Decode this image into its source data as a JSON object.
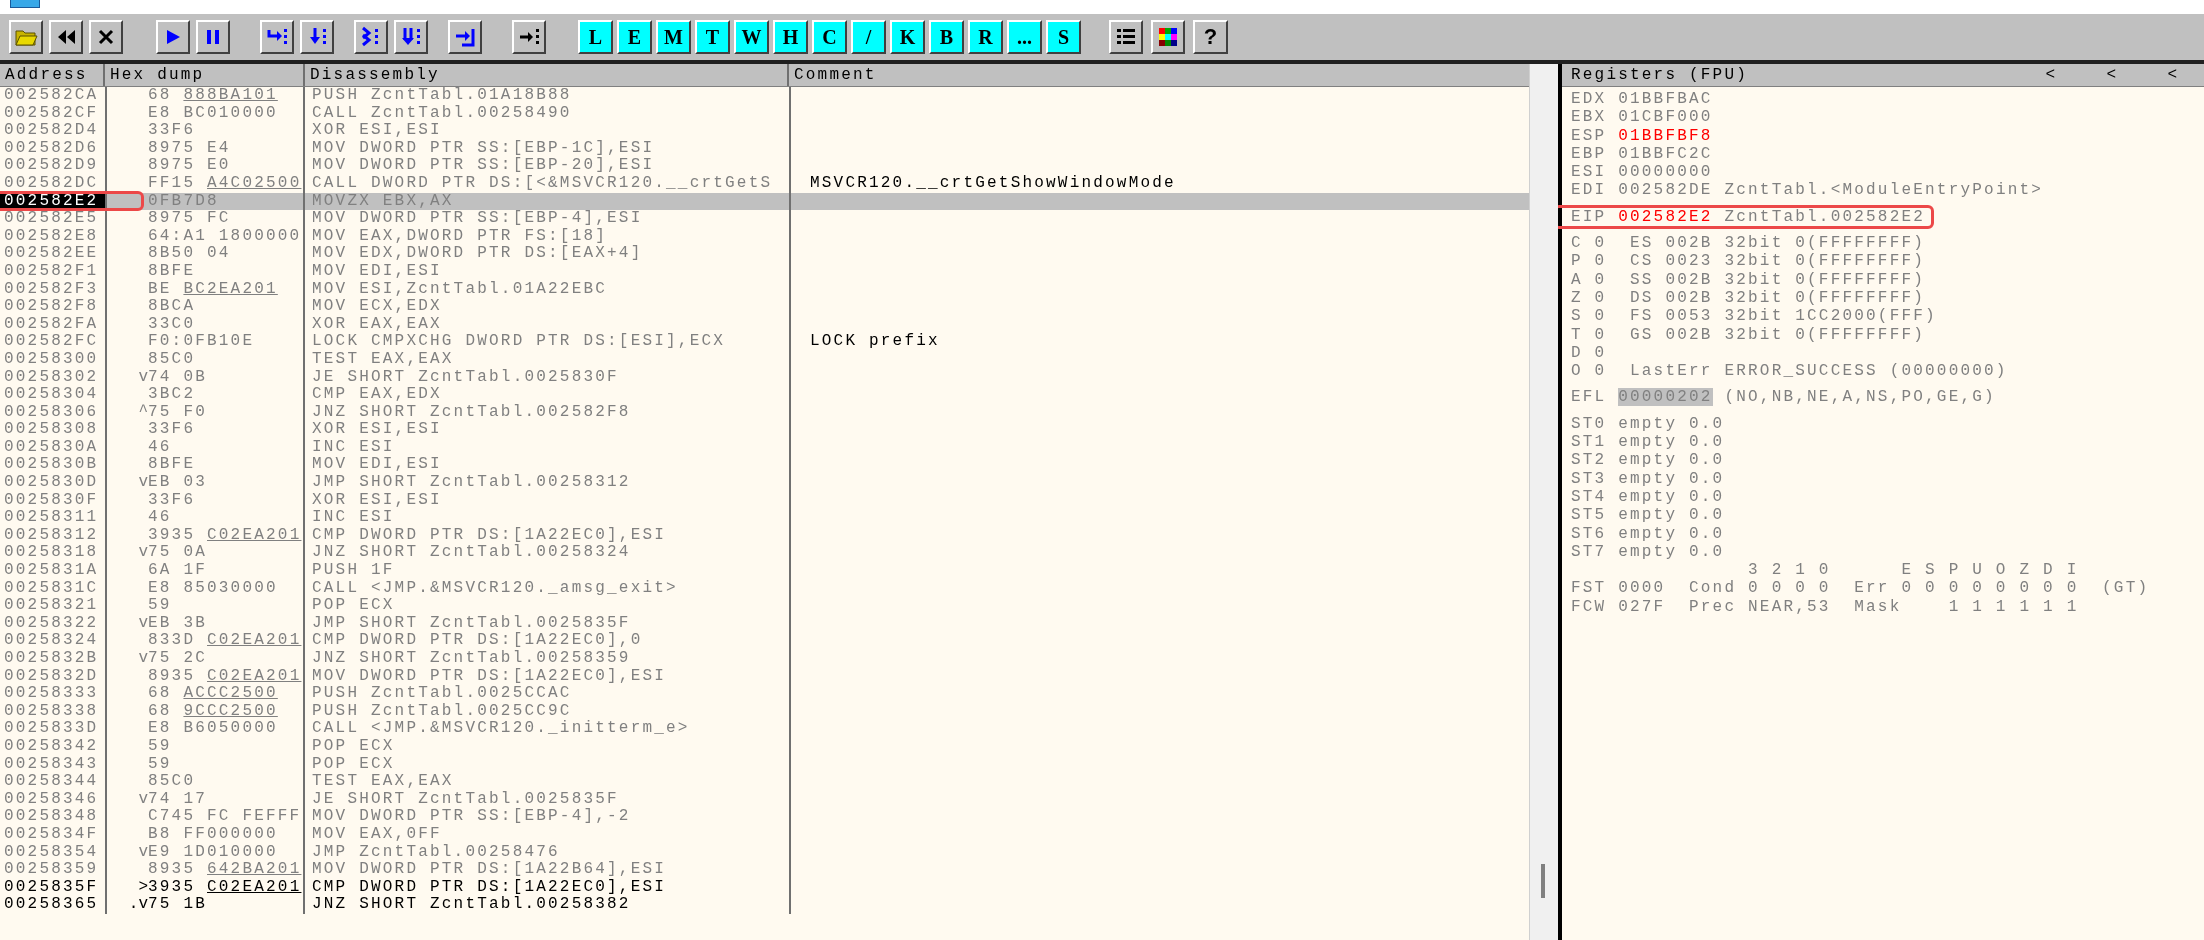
{
  "toolbar": {
    "letter_buttons": [
      "L",
      "E",
      "M",
      "T",
      "W",
      "H",
      "C",
      "/",
      "K",
      "B",
      "R",
      "...",
      "S"
    ],
    "help_button": "?"
  },
  "cpu": {
    "columns": [
      "Address",
      "Hex dump",
      "Disassembly",
      "Comment"
    ],
    "rows": [
      {
        "address": "002582CA",
        "hex": "68 ",
        "fixup": "888BA101",
        "disassembly": "PUSH ZcntTabl.01A18B88",
        "selected": false,
        "traced": false
      },
      {
        "address": "002582CF",
        "hex": "E8 BC010000",
        "disassembly": "CALL ZcntTabl.00258490",
        "selected": false,
        "traced": false
      },
      {
        "address": "002582D4",
        "hex": "33F6",
        "disassembly": "XOR ESI,ESI",
        "selected": false,
        "traced": false
      },
      {
        "address": "002582D6",
        "hex": "8975 E4",
        "disassembly": "MOV DWORD PTR SS:[EBP-1C],ESI",
        "selected": false,
        "traced": false
      },
      {
        "address": "002582D9",
        "hex": "8975 E0",
        "disassembly": "MOV DWORD PTR SS:[EBP-20],ESI",
        "selected": false,
        "traced": false
      },
      {
        "address": "002582DC",
        "hex": "FF15 ",
        "fixup": "A4C02500",
        "disassembly": "CALL DWORD PTR DS:[<&MSVCR120.__crtGetS",
        "comment": "MSVCR120.__crtGetShowWindowMode",
        "selected": false,
        "traced": false
      },
      {
        "address": "002582E2",
        "hex": "0FB7D8",
        "disassembly": "MOVZX EBX,AX",
        "selected": true,
        "traced": false
      },
      {
        "address": "002582E5",
        "hex": "8975 FC",
        "disassembly": "MOV DWORD PTR SS:[EBP-4],ESI",
        "selected": false,
        "traced": false
      },
      {
        "address": "002582E8",
        "hex": "64:A1 1800000",
        "disassembly": "MOV EAX,DWORD PTR FS:[18]",
        "selected": false,
        "traced": false
      },
      {
        "address": "002582EE",
        "hex": "8B50 04",
        "disassembly": "MOV EDX,DWORD PTR DS:[EAX+4]",
        "selected": false,
        "traced": false
      },
      {
        "address": "002582F1",
        "hex": "8BFE",
        "disassembly": "MOV EDI,ESI",
        "selected": false,
        "traced": false
      },
      {
        "address": "002582F3",
        "hex": "BE ",
        "fixup": "BC2EA201",
        "disassembly": "MOV ESI,ZcntTabl.01A22EBC",
        "selected": false,
        "traced": false
      },
      {
        "address": "002582F8",
        "hex": "8BCA",
        "disassembly": "MOV ECX,EDX",
        "selected": false,
        "traced": false
      },
      {
        "address": "002582FA",
        "hex": "33C0",
        "disassembly": "XOR EAX,EAX",
        "selected": false,
        "traced": false
      },
      {
        "address": "002582FC",
        "hex": "F0:0FB10E",
        "disassembly": "LOCK CMPXCHG DWORD PTR DS:[ESI],ECX",
        "comment": "LOCK prefix",
        "selected": false,
        "traced": false
      },
      {
        "address": "00258300",
        "hex": "85C0",
        "disassembly": "TEST EAX,EAX",
        "selected": false,
        "traced": false
      },
      {
        "address": "00258302",
        "mark": "v",
        "hex": "74 0B",
        "disassembly": "JE SHORT ZcntTabl.0025830F",
        "selected": false,
        "traced": false
      },
      {
        "address": "00258304",
        "hex": "3BC2",
        "disassembly": "CMP EAX,EDX",
        "selected": false,
        "traced": false
      },
      {
        "address": "00258306",
        "mark": "^",
        "hex": "75 F0",
        "disassembly": "JNZ SHORT ZcntTabl.002582F8",
        "selected": false,
        "traced": false
      },
      {
        "address": "00258308",
        "hex": "33F6",
        "disassembly": "XOR ESI,ESI",
        "selected": false,
        "traced": false
      },
      {
        "address": "0025830A",
        "hex": "46",
        "disassembly": "INC ESI",
        "selected": false,
        "traced": false
      },
      {
        "address": "0025830B",
        "hex": "8BFE",
        "disassembly": "MOV EDI,ESI",
        "selected": false,
        "traced": false
      },
      {
        "address": "0025830D",
        "mark": "v",
        "hex": "EB 03",
        "disassembly": "JMP SHORT ZcntTabl.00258312",
        "selected": false,
        "traced": false
      },
      {
        "address": "0025830F",
        "hex": "33F6",
        "disassembly": "XOR ESI,ESI",
        "selected": false,
        "traced": false
      },
      {
        "address": "00258311",
        "hex": "46",
        "disassembly": "INC ESI",
        "selected": false,
        "traced": false
      },
      {
        "address": "00258312",
        "hex": "3935 ",
        "fixup": "C02EA201",
        "disassembly": "CMP DWORD PTR DS:[1A22EC0],ESI",
        "selected": false,
        "traced": false
      },
      {
        "address": "00258318",
        "mark": "v",
        "hex": "75 0A",
        "disassembly": "JNZ SHORT ZcntTabl.00258324",
        "selected": false,
        "traced": false
      },
      {
        "address": "0025831A",
        "hex": "6A 1F",
        "disassembly": "PUSH 1F",
        "selected": false,
        "traced": false
      },
      {
        "address": "0025831C",
        "hex": "E8 85030000",
        "disassembly": "CALL <JMP.&MSVCR120._amsg_exit>",
        "selected": false,
        "traced": false
      },
      {
        "address": "00258321",
        "hex": "59",
        "disassembly": "POP ECX",
        "selected": false,
        "traced": false
      },
      {
        "address": "00258322",
        "mark": "v",
        "hex": "EB 3B",
        "disassembly": "JMP SHORT ZcntTabl.0025835F",
        "selected": false,
        "traced": false
      },
      {
        "address": "00258324",
        "hex": "833D ",
        "fixup": "C02EA201",
        "disassembly": "CMP DWORD PTR DS:[1A22EC0],0",
        "selected": false,
        "traced": false
      },
      {
        "address": "0025832B",
        "mark": "v",
        "hex": "75 2C",
        "disassembly": "JNZ SHORT ZcntTabl.00258359",
        "selected": false,
        "traced": false
      },
      {
        "address": "0025832D",
        "hex": "8935 ",
        "fixup": "C02EA201",
        "disassembly": "MOV DWORD PTR DS:[1A22EC0],ESI",
        "selected": false,
        "traced": false
      },
      {
        "address": "00258333",
        "hex": "68 ",
        "fixup": "ACCC2500",
        "disassembly": "PUSH ZcntTabl.0025CCAC",
        "selected": false,
        "traced": false
      },
      {
        "address": "00258338",
        "hex": "68 ",
        "fixup": "9CCC2500",
        "disassembly": "PUSH ZcntTabl.0025CC9C",
        "selected": false,
        "traced": false
      },
      {
        "address": "0025833D",
        "hex": "E8 B6050000",
        "disassembly": "CALL <JMP.&MSVCR120._initterm_e>",
        "selected": false,
        "traced": false
      },
      {
        "address": "00258342",
        "hex": "59",
        "disassembly": "POP ECX",
        "selected": false,
        "traced": false
      },
      {
        "address": "00258343",
        "hex": "59",
        "disassembly": "POP ECX",
        "selected": false,
        "traced": false
      },
      {
        "address": "00258344",
        "hex": "85C0",
        "disassembly": "TEST EAX,EAX",
        "selected": false,
        "traced": false
      },
      {
        "address": "00258346",
        "mark": "v",
        "hex": "74 17",
        "disassembly": "JE SHORT ZcntTabl.0025835F",
        "selected": false,
        "traced": false
      },
      {
        "address": "00258348",
        "hex": "C745 FC FEFFF",
        "disassembly": "MOV DWORD PTR SS:[EBP-4],-2",
        "selected": false,
        "traced": false
      },
      {
        "address": "0025834F",
        "hex": "B8 FF000000",
        "disassembly": "MOV EAX,0FF",
        "selected": false,
        "traced": false
      },
      {
        "address": "00258354",
        "mark": "v",
        "hex": "E9 1D010000",
        "disassembly": "JMP ZcntTabl.00258476",
        "selected": false,
        "traced": false
      },
      {
        "address": "00258359",
        "hex": "8935 ",
        "fixup": "642BA201",
        "disassembly": "MOV DWORD PTR DS:[1A22B64],ESI",
        "selected": false,
        "traced": false
      },
      {
        "address": "0025835F",
        "mark": ">",
        "hex": "3935 ",
        "fixup": "C02EA201",
        "disassembly": "CMP DWORD PTR DS:[1A22EC0],ESI",
        "selected": false,
        "traced": true
      },
      {
        "address": "00258365",
        "mark": ".v",
        "hex": "75 1B",
        "disassembly": "JNZ SHORT ZcntTabl.00258382",
        "selected": false,
        "traced": true
      }
    ]
  },
  "registers": {
    "title": "Registers (FPU)",
    "arrows": [
      "<",
      "<",
      "<"
    ],
    "groups": [
      [
        {
          "kind": "reg",
          "name": "EDX",
          "value": "01BBFBAC",
          "changed": false,
          "boxed": false
        },
        {
          "kind": "reg",
          "name": "EBX",
          "value": "01CBF000",
          "changed": false,
          "boxed": false
        },
        {
          "kind": "reg",
          "name": "ESP",
          "value": "01BBFBF8",
          "changed": true,
          "boxed": false
        },
        {
          "kind": "reg",
          "name": "EBP",
          "value": "01BBFC2C",
          "changed": false,
          "boxed": false
        },
        {
          "kind": "reg",
          "name": "ESI",
          "value": "00000000",
          "changed": false,
          "boxed": false
        },
        {
          "kind": "reg",
          "name": "EDI",
          "value": "002582DE",
          "info": "ZcntTabl.<ModuleEntryPoint>",
          "changed": false,
          "boxed": false
        }
      ],
      [
        {
          "kind": "reg",
          "name": "EIP",
          "value": "002582E2",
          "info": "ZcntTabl.002582E2",
          "changed": true,
          "boxed": true
        }
      ],
      [
        {
          "kind": "text",
          "text": "C 0  ES 002B 32bit 0(FFFFFFFF)"
        },
        {
          "kind": "text",
          "text": "P 0  CS 0023 32bit 0(FFFFFFFF)"
        },
        {
          "kind": "text",
          "text": "A 0  SS 002B 32bit 0(FFFFFFFF)"
        },
        {
          "kind": "text",
          "text": "Z 0  DS 002B 32bit 0(FFFFFFFF)"
        },
        {
          "kind": "text",
          "text": "S 0  FS 0053 32bit 1CC2000(FFF)"
        },
        {
          "kind": "text",
          "text": "T 0  GS 002B 32bit 0(FFFFFFFF)"
        },
        {
          "kind": "text",
          "text": "D 0"
        },
        {
          "kind": "text",
          "text": "O 0  LastErr ERROR_SUCCESS (00000000)"
        }
      ],
      [
        {
          "kind": "efl",
          "name": "EFL",
          "value": "00000202",
          "info": "(NO,NB,NE,A,NS,PO,GE,G)"
        }
      ],
      [
        {
          "kind": "text",
          "text": "ST0 empty 0.0"
        },
        {
          "kind": "text",
          "text": "ST1 empty 0.0"
        },
        {
          "kind": "text",
          "text": "ST2 empty 0.0"
        },
        {
          "kind": "text",
          "text": "ST3 empty 0.0"
        },
        {
          "kind": "text",
          "text": "ST4 empty 0.0"
        },
        {
          "kind": "text",
          "text": "ST5 empty 0.0"
        },
        {
          "kind": "text",
          "text": "ST6 empty 0.0"
        },
        {
          "kind": "text",
          "text": "ST7 empty 0.0"
        },
        {
          "kind": "text",
          "text": "               3 2 1 0      E S P U O Z D I"
        },
        {
          "kind": "text",
          "text": "FST 0000  Cond 0 0 0 0  Err 0 0 0 0 0 0 0 0  (GT)"
        },
        {
          "kind": "text",
          "text": "FCW 027F  Prec NEAR,53  Mask    1 1 1 1 1 1"
        }
      ]
    ]
  }
}
